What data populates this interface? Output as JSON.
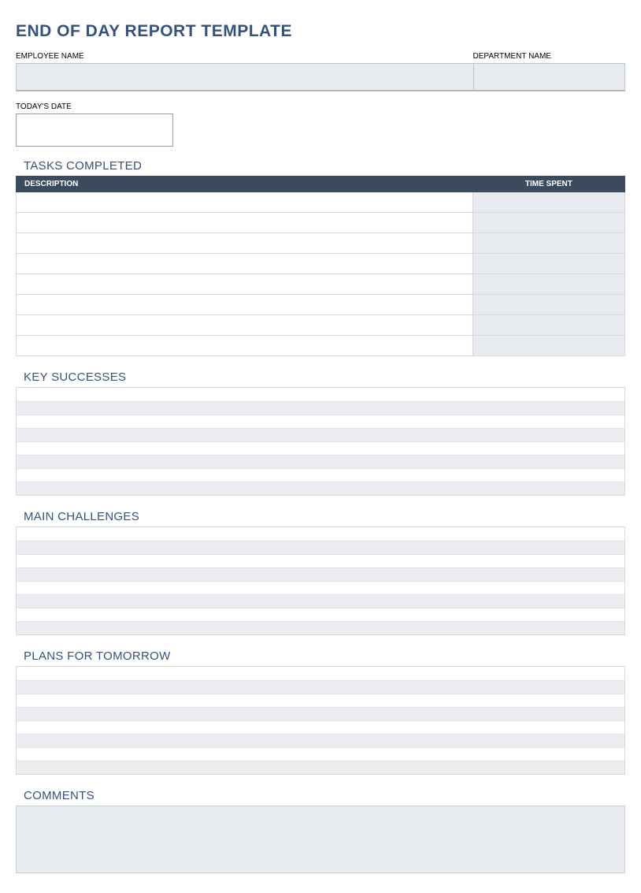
{
  "title": "END OF DAY REPORT TEMPLATE",
  "labels": {
    "employee_name": "EMPLOYEE NAME",
    "department_name": "DEPARTMENT NAME",
    "todays_date": "TODAY'S DATE"
  },
  "fields": {
    "employee_name": "",
    "department_name": "",
    "todays_date": "",
    "comments": ""
  },
  "sections": {
    "tasks_completed": "TASKS COMPLETED",
    "key_successes": "KEY SUCCESSES",
    "main_challenges": "MAIN CHALLENGES",
    "plans_for_tomorrow": "PLANS FOR TOMORROW",
    "comments": "COMMENTS"
  },
  "tasks_table": {
    "headers": {
      "description": "DESCRIPTION",
      "time_spent": "TIME SPENT"
    },
    "rows": [
      {
        "description": "",
        "time_spent": ""
      },
      {
        "description": "",
        "time_spent": ""
      },
      {
        "description": "",
        "time_spent": ""
      },
      {
        "description": "",
        "time_spent": ""
      },
      {
        "description": "",
        "time_spent": ""
      },
      {
        "description": "",
        "time_spent": ""
      },
      {
        "description": "",
        "time_spent": ""
      },
      {
        "description": "",
        "time_spent": ""
      }
    ]
  },
  "key_successes_rows": [
    "",
    "",
    "",
    "",
    "",
    "",
    "",
    ""
  ],
  "main_challenges_rows": [
    "",
    "",
    "",
    "",
    "",
    "",
    "",
    ""
  ],
  "plans_for_tomorrow_rows": [
    "",
    "",
    "",
    "",
    "",
    "",
    "",
    ""
  ]
}
